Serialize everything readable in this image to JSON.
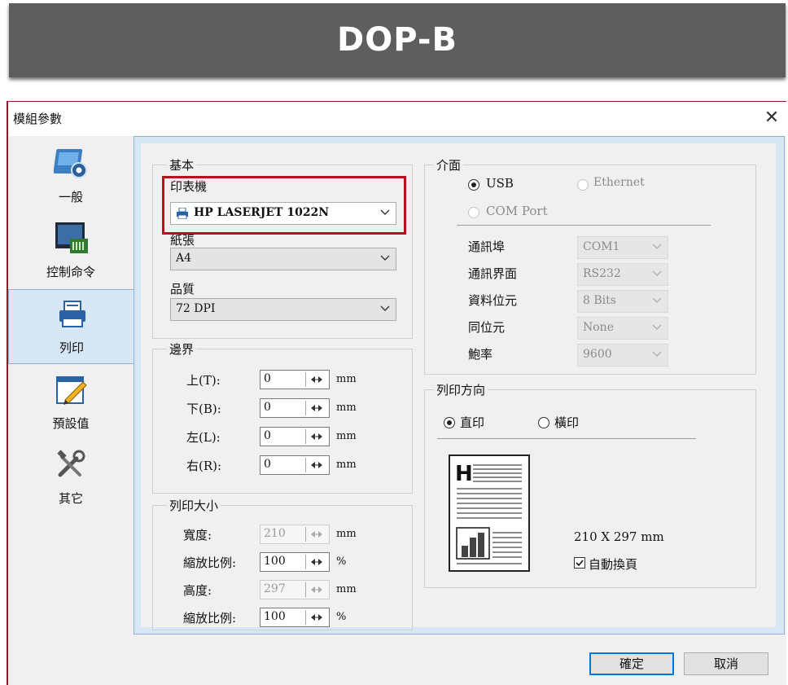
{
  "banner": {
    "title": "DOP-B"
  },
  "dialog": {
    "title": "模組參數",
    "close_glyph": "✕",
    "nav": [
      {
        "label": "一般",
        "icon": "settings-icon"
      },
      {
        "label": "控制命令",
        "icon": "terminal-icon"
      },
      {
        "label": "列印",
        "icon": "printer-icon",
        "selected": true
      },
      {
        "label": "預設值",
        "icon": "edit-icon"
      },
      {
        "label": "其它",
        "icon": "tools-icon"
      }
    ],
    "basic": {
      "title": "基本",
      "printer_label": "印表機",
      "printer_value": "HP LASERJET 1022N",
      "paper_label": "紙張",
      "paper_value": "A4",
      "quality_label": "品質",
      "quality_value": "72 DPI"
    },
    "margin": {
      "title": "邊界",
      "rows": [
        {
          "label": "上(T):",
          "value": "0",
          "unit": "mm"
        },
        {
          "label": "下(B):",
          "value": "0",
          "unit": "mm"
        },
        {
          "label": "左(L):",
          "value": "0",
          "unit": "mm"
        },
        {
          "label": "右(R):",
          "value": "0",
          "unit": "mm"
        }
      ]
    },
    "print_size": {
      "title": "列印大小",
      "rows": [
        {
          "label": "寬度:",
          "value": "210",
          "unit": "mm",
          "disabled": true
        },
        {
          "label": "縮放比例:",
          "value": "100",
          "unit": "%",
          "disabled": false
        },
        {
          "label": "高度:",
          "value": "297",
          "unit": "mm",
          "disabled": true
        },
        {
          "label": "縮放比例:",
          "value": "100",
          "unit": "%",
          "disabled": false
        }
      ]
    },
    "interface": {
      "title": "介面",
      "usb": "USB",
      "ethernet": "Ethernet",
      "com": "COM Port",
      "selected": "USB",
      "fields": [
        {
          "label": "通訊埠",
          "value": "COM1"
        },
        {
          "label": "通訊界面",
          "value": "RS232"
        },
        {
          "label": "資料位元",
          "value": "8 Bits"
        },
        {
          "label": "同位元",
          "value": "None"
        },
        {
          "label": "鮑率",
          "value": "9600"
        }
      ]
    },
    "orientation": {
      "title": "列印方向",
      "portrait": "直印",
      "landscape": "橫印",
      "selected": "直印",
      "size_text": "210 X 297 mm",
      "auto_page_label": "自動換頁",
      "auto_page_checked": true
    },
    "buttons": {
      "ok": "確定",
      "cancel": "取消"
    },
    "colors": {
      "highlight": "#b8101e",
      "accent": "#0078d7",
      "panel": "#d8e7f5"
    }
  }
}
